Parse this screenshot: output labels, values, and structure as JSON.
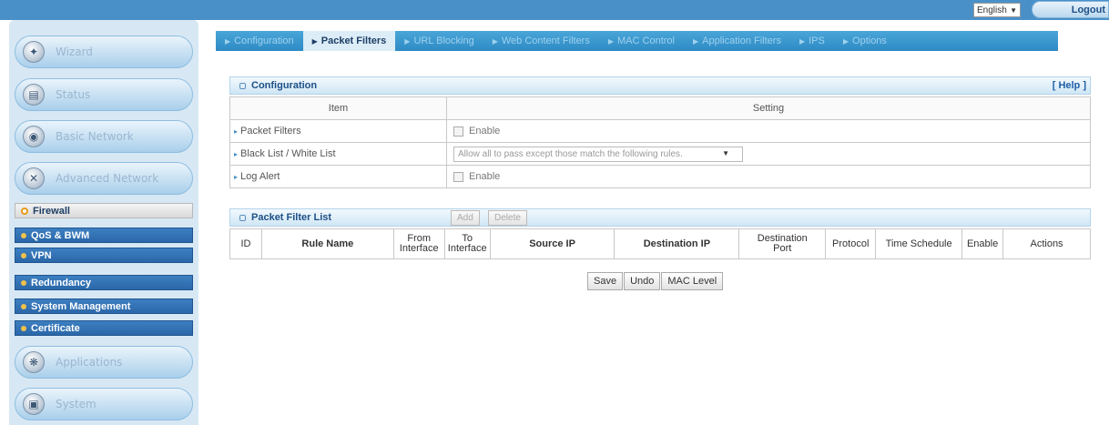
{
  "header": {
    "language": "English",
    "logout_label": "Logout"
  },
  "sidebar": {
    "main_buttons": [
      {
        "label": "Wizard",
        "icon": "wand-icon"
      },
      {
        "label": "Status",
        "icon": "status-icon"
      },
      {
        "label": "Basic Network",
        "icon": "globe-icon"
      },
      {
        "label": "Advanced Network",
        "icon": "tools-icon"
      }
    ],
    "sub_items": [
      {
        "label": "Firewall",
        "active": true
      },
      {
        "label": "QoS & BWM"
      },
      {
        "label": "VPN"
      },
      {
        "label": "Redundancy"
      },
      {
        "label": "System Management"
      },
      {
        "label": "Certificate"
      }
    ],
    "bottom_buttons": [
      {
        "label": "Applications",
        "icon": "applications-icon"
      },
      {
        "label": "System",
        "icon": "system-icon"
      }
    ]
  },
  "tabs": [
    {
      "label": "Configuration"
    },
    {
      "label": "Packet Filters",
      "active": true
    },
    {
      "label": "URL Blocking"
    },
    {
      "label": "Web Content Filters"
    },
    {
      "label": "MAC Control"
    },
    {
      "label": "Application Filters"
    },
    {
      "label": "IPS"
    },
    {
      "label": "Options"
    }
  ],
  "configuration": {
    "title": "Configuration",
    "help_label": "[ Help ]",
    "col_item": "Item",
    "col_setting": "Setting",
    "rows": {
      "packet_filters": {
        "label": "Packet Filters",
        "value": "Enable"
      },
      "black_white_list": {
        "label": "Black List / White List",
        "value": "Allow all to pass except those match the following rules."
      },
      "log_alert": {
        "label": "Log Alert",
        "value": "Enable"
      }
    }
  },
  "packet_filter_list": {
    "title": "Packet Filter List",
    "add_label": "Add",
    "delete_label": "Delete",
    "columns": {
      "id": "ID",
      "rule_name": "Rule Name",
      "from_1": "From",
      "from_2": "Interface",
      "to_1": "To",
      "to_2": "Interface",
      "source_ip": "Source IP",
      "destination_ip": "Destination IP",
      "dest_port_1": "Destination",
      "dest_port_2": "Port",
      "protocol": "Protocol",
      "time_schedule": "Time Schedule",
      "enable": "Enable",
      "actions": "Actions"
    }
  },
  "footer": {
    "save_label": "Save",
    "undo_label": "Undo",
    "mac_level_label": "MAC Level"
  }
}
